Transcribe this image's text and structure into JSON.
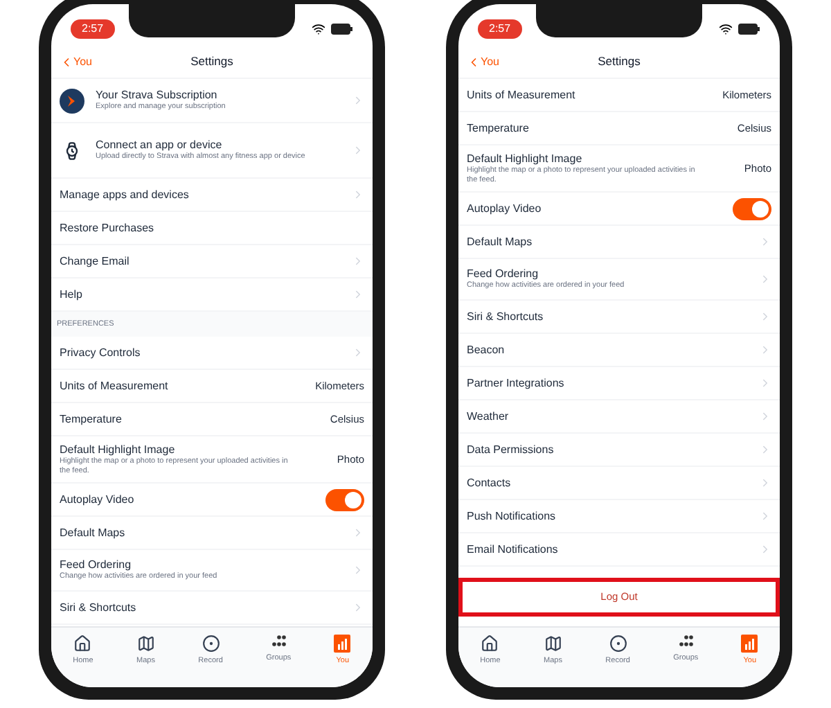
{
  "phones": [
    {
      "status_time": "2:57",
      "nav": {
        "back": "You",
        "title": "Settings"
      },
      "rows": [
        {
          "kind": "subscription",
          "label": "Your Strava Subscription",
          "subtitle": "Explore and manage your subscription"
        },
        {
          "kind": "connect",
          "label": "Connect an app or device",
          "subtitle": "Upload directly to Strava with almost any fitness app or device"
        },
        {
          "kind": "link",
          "label": "Manage apps and devices"
        },
        {
          "kind": "plain",
          "label": "Restore Purchases"
        },
        {
          "kind": "link",
          "label": "Change Email"
        },
        {
          "kind": "link",
          "label": "Help"
        },
        {
          "kind": "section",
          "label": "PREFERENCES"
        },
        {
          "kind": "link",
          "label": "Privacy Controls"
        },
        {
          "kind": "value",
          "label": "Units of Measurement",
          "value": "Kilometers"
        },
        {
          "kind": "value",
          "label": "Temperature",
          "value": "Celsius"
        },
        {
          "kind": "value_sub",
          "label": "Default Highlight Image",
          "subtitle": "Highlight the map or a photo to represent your uploaded activities in the feed.",
          "value": "Photo"
        },
        {
          "kind": "toggle",
          "label": "Autoplay Video",
          "on": true
        },
        {
          "kind": "link",
          "label": "Default Maps"
        },
        {
          "kind": "link_sub",
          "label": "Feed Ordering",
          "subtitle": "Change how activities are ordered in your feed"
        },
        {
          "kind": "link",
          "label": "Siri & Shortcuts"
        }
      ],
      "tab_bar": [
        {
          "label": "Home",
          "selected": false
        },
        {
          "label": "Maps",
          "selected": false
        },
        {
          "label": "Record",
          "selected": false
        },
        {
          "label": "Groups",
          "selected": false
        },
        {
          "label": "You",
          "selected": true
        }
      ]
    },
    {
      "status_time": "2:57",
      "nav": {
        "back": "You",
        "title": "Settings"
      },
      "rows": [
        {
          "kind": "value",
          "label": "Units of Measurement",
          "value": "Kilometers"
        },
        {
          "kind": "value",
          "label": "Temperature",
          "value": "Celsius"
        },
        {
          "kind": "value_sub",
          "label": "Default Highlight Image",
          "subtitle": "Highlight the map or a photo to represent your uploaded activities in the feed.",
          "value": "Photo"
        },
        {
          "kind": "toggle",
          "label": "Autoplay Video",
          "on": true
        },
        {
          "kind": "link",
          "label": "Default Maps"
        },
        {
          "kind": "link_sub",
          "label": "Feed Ordering",
          "subtitle": "Change how activities are ordered in your feed"
        },
        {
          "kind": "link",
          "label": "Siri & Shortcuts"
        },
        {
          "kind": "link",
          "label": "Beacon"
        },
        {
          "kind": "link",
          "label": "Partner Integrations"
        },
        {
          "kind": "link",
          "label": "Weather"
        },
        {
          "kind": "link",
          "label": "Data Permissions"
        },
        {
          "kind": "link",
          "label": "Contacts"
        },
        {
          "kind": "link",
          "label": "Push Notifications"
        },
        {
          "kind": "link",
          "label": "Email Notifications"
        },
        {
          "kind": "button",
          "label": "Log Out",
          "highlighted": true
        }
      ],
      "tab_bar": [
        {
          "label": "Home",
          "selected": false
        },
        {
          "label": "Maps",
          "selected": false
        },
        {
          "label": "Record",
          "selected": false
        },
        {
          "label": "Groups",
          "selected": false
        },
        {
          "label": "You",
          "selected": true
        }
      ]
    }
  ]
}
